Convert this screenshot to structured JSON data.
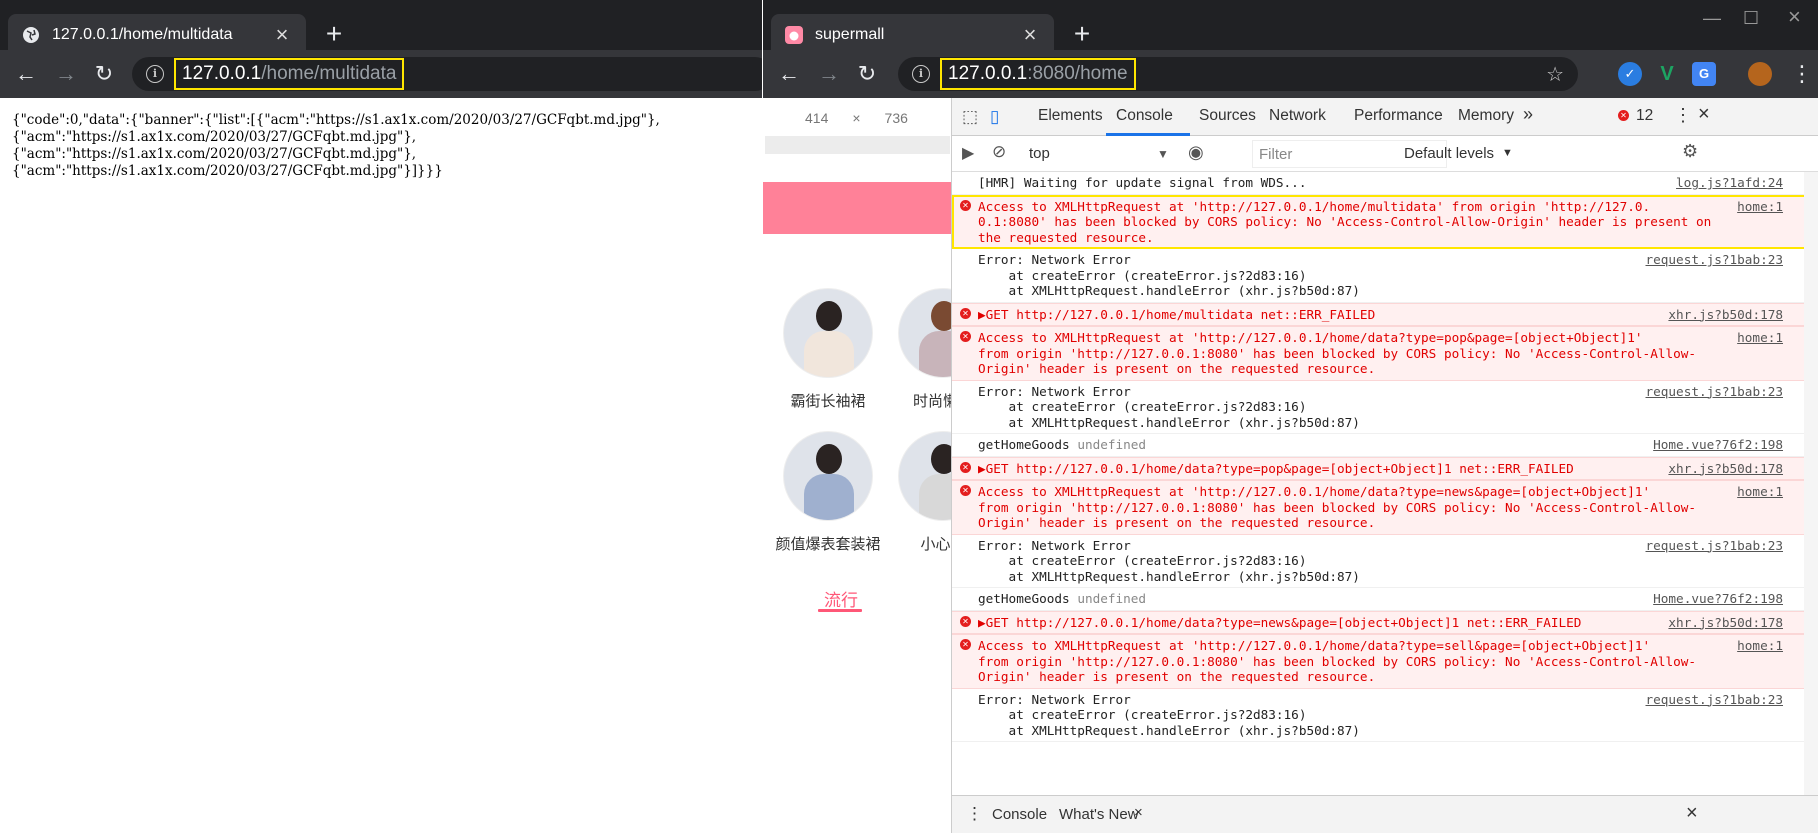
{
  "left_window": {
    "tab_title": "127.0.0.1/home/multidata",
    "url_host": "127.0.0.1",
    "url_path": "/home/multidata",
    "json_lines": [
      "{\"code\":0,\"data\":{\"banner\":{\"list\":[{\"acm\":\"https://s1.ax1x.com/2020/03/27/GCFqbt.md.jpg\"},",
      "{\"acm\":\"https://s1.ax1x.com/2020/03/27/GCFqbt.md.jpg\"},",
      "{\"acm\":\"https://s1.ax1x.com/2020/03/27/GCFqbt.md.jpg\"},",
      "{\"acm\":\"https://s1.ax1x.com/2020/03/27/GCFqbt.md.jpg\"}]}}}"
    ]
  },
  "right_window": {
    "tab_title": "supermall",
    "url_host": "127.0.0.1",
    "url_path": ":8080/home",
    "device": {
      "width": "414",
      "x": "×",
      "height": "736",
      "categories": [
        "霸街长袖裙",
        "时尚懒人",
        "颜值爆表套装裙",
        "小心机"
      ],
      "pop_tab": "流行"
    },
    "devtools": {
      "tabs": [
        "Elements",
        "Console",
        "Sources",
        "Network",
        "Performance",
        "Memory"
      ],
      "active_tab": "Console",
      "more": "»",
      "error_count": "12",
      "context": "top",
      "filter_placeholder": "Filter",
      "levels": "Default levels",
      "drawer_tabs": [
        "Console",
        "What's New"
      ],
      "messages": [
        {
          "type": "log",
          "lines": [
            "[HMR] Waiting for update signal from WDS..."
          ],
          "src": "log.js?1afd:24"
        },
        {
          "type": "error",
          "hl": true,
          "lines": [
            "Access to XMLHttpRequest at 'http://127.0.0.1/home/multidata' from origin 'http://127.0.",
            "0.1:8080' has been blocked by CORS policy: No 'Access-Control-Allow-Origin' header is present on",
            "the requested resource."
          ],
          "src": "home:1"
        },
        {
          "type": "log",
          "lines": [
            "Error: Network Error",
            "    at createError (createError.js?2d83:16)",
            "    at XMLHttpRequest.handleError (xhr.js?b50d:87)"
          ],
          "src": "request.js?1bab:23"
        },
        {
          "type": "error",
          "lines": [
            "▶GET http://127.0.0.1/home/multidata net::ERR_FAILED"
          ],
          "src": "xhr.js?b50d:178"
        },
        {
          "type": "error",
          "lines": [
            "Access to XMLHttpRequest at 'http://127.0.0.1/home/data?type=pop&page=[object+Object]1'",
            "from origin 'http://127.0.0.1:8080' has been blocked by CORS policy: No 'Access-Control-Allow-",
            "Origin' header is present on the requested resource."
          ],
          "src": "home:1"
        },
        {
          "type": "log",
          "lines": [
            "Error: Network Error",
            "    at createError (createError.js?2d83:16)",
            "    at XMLHttpRequest.handleError (xhr.js?b50d:87)"
          ],
          "src": "request.js?1bab:23"
        },
        {
          "type": "log",
          "lines": [
            "getHomeGoods undefined"
          ],
          "src": "Home.vue?76f2:198"
        },
        {
          "type": "error",
          "lines": [
            "▶GET http://127.0.0.1/home/data?type=pop&page=[object+Object]1 net::ERR_FAILED"
          ],
          "src": "xhr.js?b50d:178"
        },
        {
          "type": "error",
          "lines": [
            "Access to XMLHttpRequest at 'http://127.0.0.1/home/data?type=news&page=[object+Object]1'",
            "from origin 'http://127.0.0.1:8080' has been blocked by CORS policy: No 'Access-Control-Allow-",
            "Origin' header is present on the requested resource."
          ],
          "src": "home:1"
        },
        {
          "type": "log",
          "lines": [
            "Error: Network Error",
            "    at createError (createError.js?2d83:16)",
            "    at XMLHttpRequest.handleError (xhr.js?b50d:87)"
          ],
          "src": "request.js?1bab:23"
        },
        {
          "type": "log",
          "lines": [
            "getHomeGoods undefined"
          ],
          "src": "Home.vue?76f2:198"
        },
        {
          "type": "error",
          "lines": [
            "▶GET http://127.0.0.1/home/data?type=news&page=[object+Object]1 net::ERR_FAILED"
          ],
          "src": "xhr.js?b50d:178"
        },
        {
          "type": "error",
          "lines": [
            "Access to XMLHttpRequest at 'http://127.0.0.1/home/data?type=sell&page=[object+Object]1'",
            "from origin 'http://127.0.0.1:8080' has been blocked by CORS policy: No 'Access-Control-Allow-",
            "Origin' header is present on the requested resource."
          ],
          "src": "home:1"
        },
        {
          "type": "log",
          "lines": [
            "Error: Network Error",
            "    at createError (createError.js?2d83:16)",
            "    at XMLHttpRequest.handleError (xhr.js?b50d:87)"
          ],
          "src": "request.js?1bab:23"
        }
      ]
    }
  },
  "colors": {
    "highlight": "#ffe600",
    "pink": "#ff8198",
    "accent": "#ff5777",
    "error": "#e10000"
  }
}
